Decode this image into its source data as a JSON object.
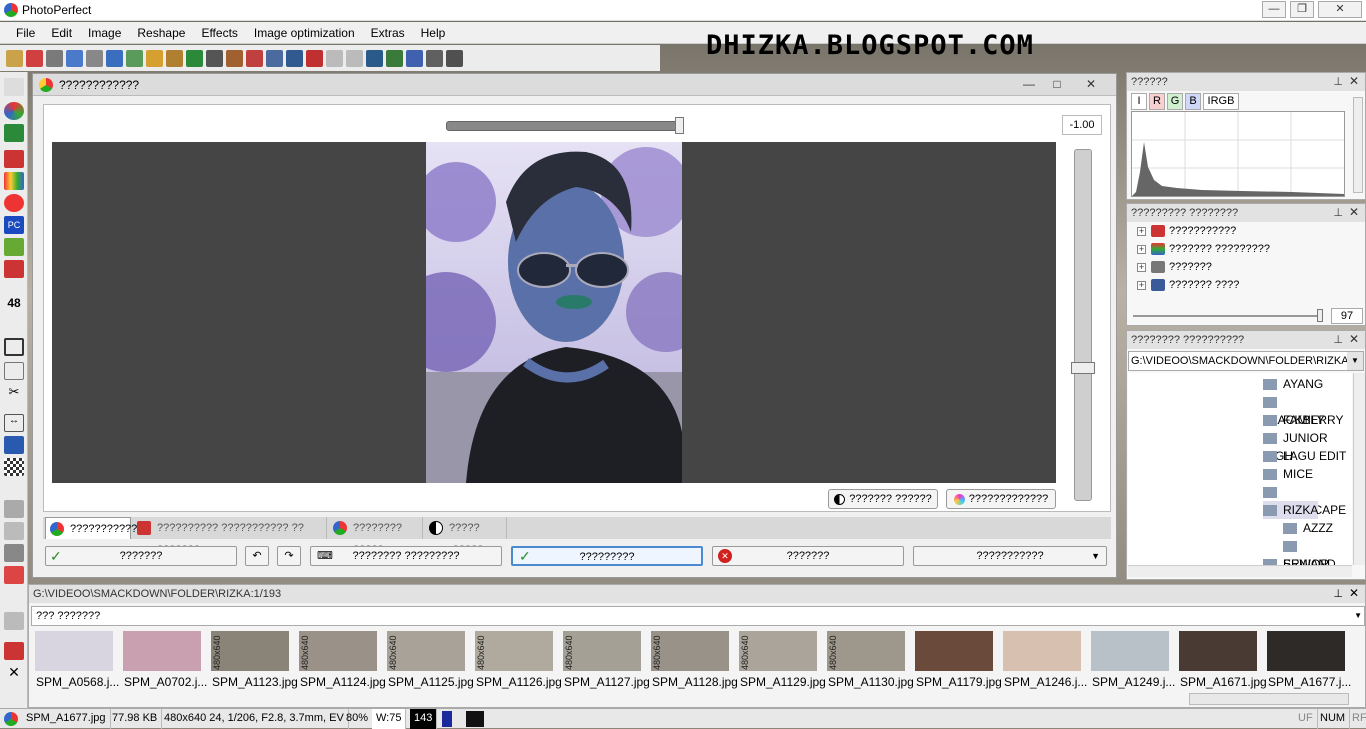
{
  "app": {
    "title": "PhotoPerfect"
  },
  "watermark": "DHIZKA.BLOGSPOT.COM",
  "menu": [
    "File",
    "Edit",
    "Image",
    "Reshape",
    "Effects",
    "Image optimization",
    "Extras",
    "Help"
  ],
  "editor": {
    "title": "????????????",
    "slider_value": "-1.00",
    "buttons": {
      "btn1": "??????? ??????",
      "btn2": "?????????????"
    },
    "tabs": [
      "???????????",
      "?????????? ??????????? ?? ???????",
      "???????? ?????",
      "?????-?????"
    ],
    "actions": [
      "???????",
      "???????? ?????????",
      "?????????",
      "???????",
      "???????????"
    ]
  },
  "histogram_panel": {
    "title": "??????",
    "tabs": [
      "I",
      "R",
      "G",
      "B",
      "IRGB"
    ]
  },
  "tree_panel": {
    "title": "????????? ????????",
    "items": [
      "???????????",
      "??????? ?????????",
      "???????",
      "??????? ????"
    ],
    "slider_value": "97"
  },
  "folder_panel": {
    "title": "???????? ??????????",
    "path": "G:\\VIDEOO\\SMACKDOWN\\FOLDER\\RIZKA",
    "folders": [
      "AYANG",
      "BLACKBERRY",
      "FAMILY",
      "JUNIOR HIGH",
      "LAGU EDIT",
      "MICE",
      "PHOTOSCAPE",
      "RIZKA",
      "AZZZ",
      "ERWAND",
      "SENIOR HIGH"
    ]
  },
  "filmstrip": {
    "header": "G:\\VIDEOO\\SMACKDOWN\\FOLDER\\RIZKA:1/193",
    "filter": "??? ???????",
    "rotated_label": "480x640",
    "files": [
      "SPM_A0568.j...",
      "SPM_A0702.j...",
      "SPM_A1123.jpg",
      "SPM_A1124.jpg",
      "SPM_A1125.jpg",
      "SPM_A1126.jpg",
      "SPM_A1127.jpg",
      "SPM_A1128.jpg",
      "SPM_A1129.jpg",
      "SPM_A1130.jpg",
      "SPM_A1179.jpg",
      "SPM_A1246.j...",
      "SPM_A1249.j...",
      "SPM_A1671.jpg",
      "SPM_A1677.j..."
    ]
  },
  "status": {
    "file": "SPM_A1677.jpg",
    "size": "77.98 KB",
    "info": "480x640 24, 1/206, F2.8, 3.7mm, EV",
    "zoom": "80%",
    "width": "W:75",
    "count": "143",
    "uf": "UF",
    "num": "NUM",
    "rf": "RF"
  }
}
